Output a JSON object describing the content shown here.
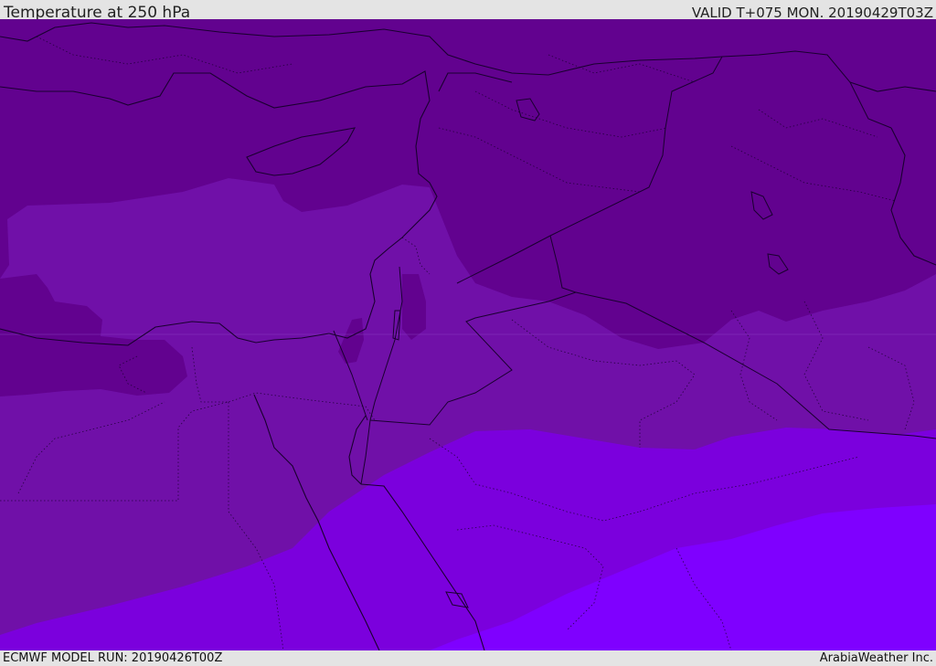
{
  "header": {
    "title": "Temperature at 250 hPa",
    "valid": "VALID T+075 MON. 20190429T03Z"
  },
  "footer": {
    "model_run": "ECMWF MODEL RUN: 20190426T00Z",
    "credit": "ArabiaWeather Inc."
  },
  "map": {
    "region": "Eastern Mediterranean and Middle East",
    "colors": {
      "band_cold": "#62028f",
      "band_cool": "#7010a8",
      "band_mid": "#7b00dd",
      "band_warm": "#7f00ff",
      "coastline": "#1a0030",
      "border": "#1a0030"
    }
  }
}
